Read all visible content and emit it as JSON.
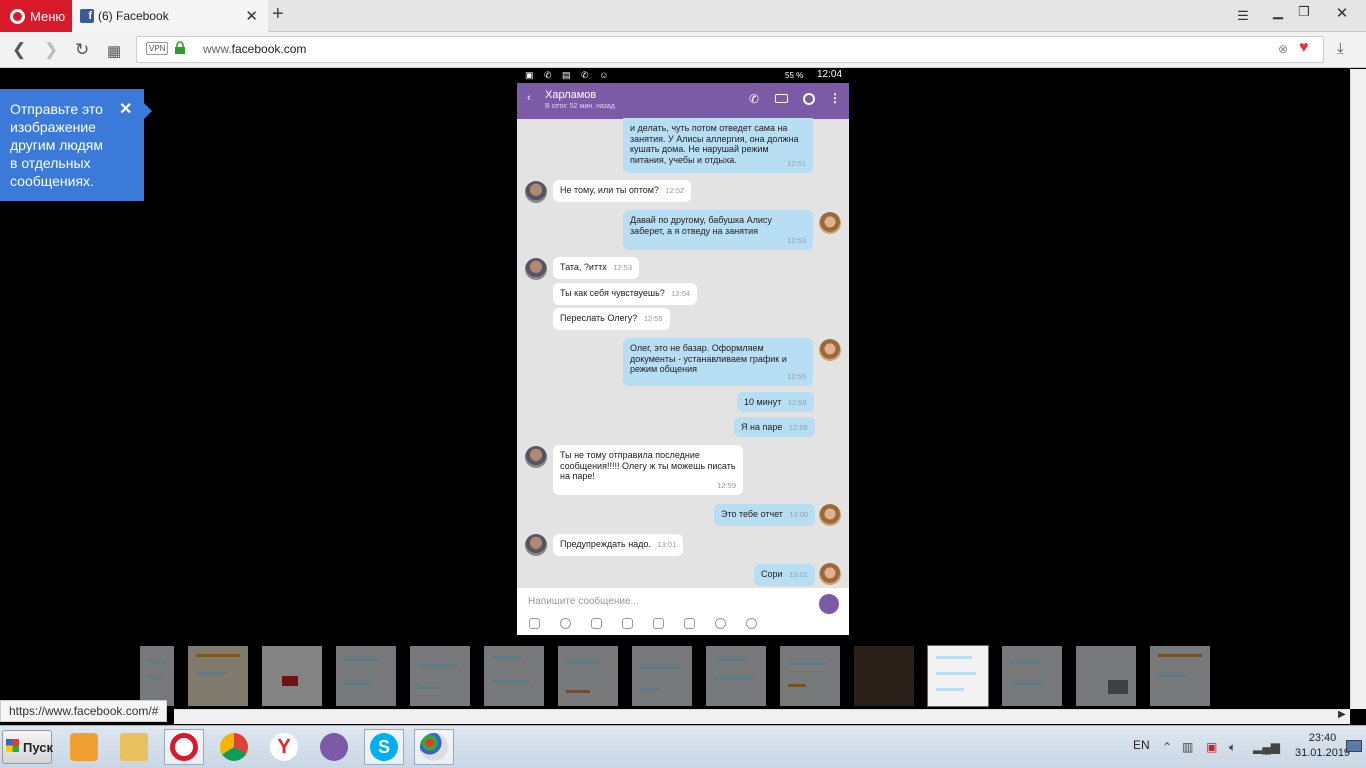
{
  "browser": {
    "menu_label": "Меню",
    "tab_title": "(6) Facebook",
    "tab_icon_letter": "f",
    "vpn_label": "VPN",
    "url_prefix": "www.",
    "url_domain": "facebook.com"
  },
  "tooltip": {
    "text_lines": [
      "Отправьте это",
      "изображение",
      "другим людям",
      "в отдельных",
      "сообщениях."
    ],
    "close_symbol": "✕"
  },
  "phone": {
    "battery": "55 %",
    "time": "12:04",
    "contact_name": "Харламов",
    "contact_status": "В сети: 52 мин. назад",
    "composer_placeholder": "Напишите сообщение...",
    "messages": [
      {
        "dir": "out",
        "text": "и делать, чуть потом отведет сама на занятия. У Алисы аллергия, она должна кушать дома. Не нарушай режим питания, учебы и отдыха.",
        "time": "12:51"
      },
      {
        "dir": "in",
        "text": "Не тому, или ты оптом?",
        "time": "12:52"
      },
      {
        "dir": "out",
        "text": "Давай по другому, бабушка Алису заберет, а я отведу на занятия",
        "time": "12:53"
      },
      {
        "dir": "in",
        "text": "Тата, ?иттх",
        "time": "12:53"
      },
      {
        "dir": "in",
        "text": "Ты как себя чувствуешь?",
        "time": "12:54"
      },
      {
        "dir": "in",
        "text": "Переслать Олегу?",
        "time": "12:55"
      },
      {
        "dir": "out",
        "text": "Олег, это не базар. Оформляем документы - устанавливаем график и режим общения",
        "time": "12:55"
      },
      {
        "dir": "out",
        "text": "10 минут",
        "time": "12:58"
      },
      {
        "dir": "out",
        "text": "Я на паре",
        "time": "12:58"
      },
      {
        "dir": "in",
        "text": "Ты не тому отправила последние сообщения!!!!! Олегу ж ты можешь писать на паре!",
        "time": "12:59"
      },
      {
        "dir": "out",
        "text": "Это тебе отчет",
        "time": "13:00"
      },
      {
        "dir": "in",
        "text": "Предупреждать надо.",
        "time": "13:01"
      },
      {
        "dir": "out",
        "text": "Сори",
        "time": "13:01"
      }
    ]
  },
  "status_url": "https://www.facebook.com/#",
  "taskbar": {
    "start_label": "Пуск",
    "apps": [
      "media-player",
      "file-explorer",
      "opera",
      "chrome",
      "yandex",
      "viber",
      "skype",
      "paint"
    ],
    "language": "EN",
    "clock_time": "23:40",
    "clock_date": "31.01.2019"
  },
  "colors": {
    "opera_red": "#d8192a",
    "viber_purple": "#7b5aa6",
    "tooltip_blue": "#3b7ad9",
    "outgoing_bubble": "#b7def3"
  }
}
